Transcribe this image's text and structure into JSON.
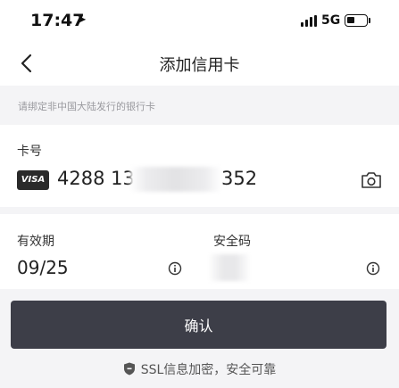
{
  "status_bar": {
    "time": "17:47",
    "network": "5G"
  },
  "nav": {
    "title": "添加信用卡"
  },
  "notice": "请绑定非中国大陆发行的银行卡",
  "card": {
    "label": "卡号",
    "brand": "VISA",
    "number_prefix": "4288 13",
    "number_suffix": "352"
  },
  "expiry": {
    "label": "有效期",
    "value": "09/25"
  },
  "cvv": {
    "label": "安全码"
  },
  "confirm_label": "确认",
  "security_note": "SSL信息加密，安全可靠"
}
